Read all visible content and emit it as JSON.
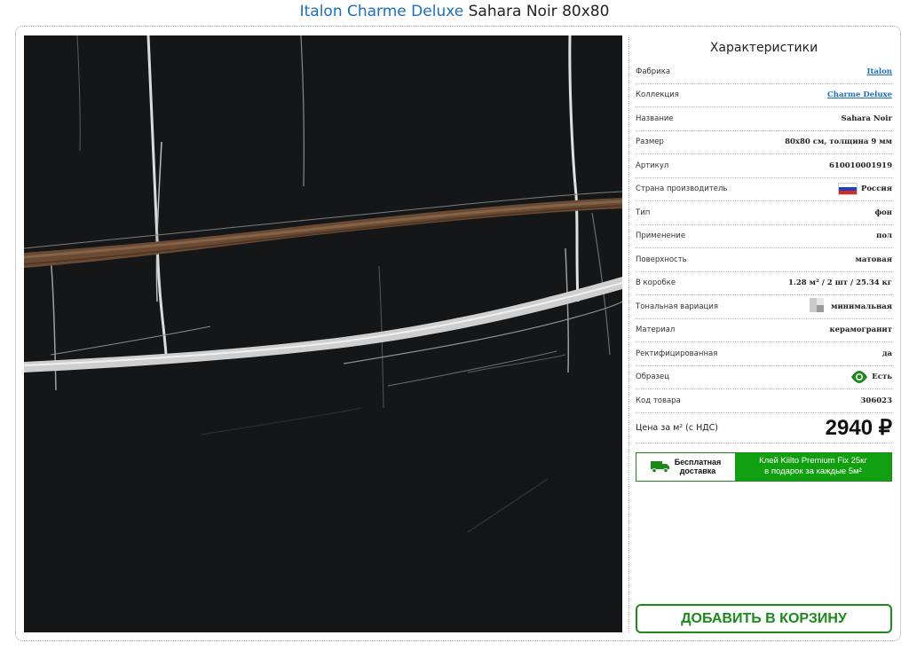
{
  "title": {
    "brand_collection": "Italon Charme Deluxe",
    "product": "Sahara Noir 80x80"
  },
  "specs": {
    "heading": "Характеристики",
    "rows": [
      {
        "label": "Фабрика",
        "value": "Italon",
        "link": true
      },
      {
        "label": "Коллекция",
        "value": "Charme Deluxe",
        "link": true
      },
      {
        "label": "Название",
        "value": "Sahara Noir"
      },
      {
        "label": "Размер",
        "value": "80x80 см, толщина 9 мм"
      },
      {
        "label": "Артикул",
        "value": "610010001919"
      },
      {
        "label": "Страна производитель",
        "value": "Россия",
        "icon": "russia-flag-icon"
      },
      {
        "label": "Тип",
        "value": "фон"
      },
      {
        "label": "Применение",
        "value": "пол"
      },
      {
        "label": "Поверхность",
        "value": "матовая"
      },
      {
        "label": "В коробке",
        "value": "1.28 м² / 2 шт / 25.34 кг"
      },
      {
        "label": "Тональная вариация",
        "value": "минимальная",
        "icon": "tone-variation-icon"
      },
      {
        "label": "Материал",
        "value": "керамогранит"
      },
      {
        "label": "Ректифицированная",
        "value": "да"
      },
      {
        "label": "Образец",
        "value": "Есть",
        "icon": "eye-icon"
      },
      {
        "label": "Код товара",
        "value": "306023"
      }
    ]
  },
  "price": {
    "label": "Цена за м² (с НДС)",
    "value": "2940 ₽"
  },
  "promo": {
    "delivery_line1": "Бесплатная",
    "delivery_line2": "доставка",
    "gift_line1": "Клей Kiilto Premium Fix 25кг",
    "gift_line2": "в подарок за каждые 5м²"
  },
  "cart_button": "ДОБАВИТЬ В КОРЗИНУ",
  "colors": {
    "link": "#1a6fc0",
    "green": "#1b8a1b",
    "green_fill": "#10a010"
  }
}
